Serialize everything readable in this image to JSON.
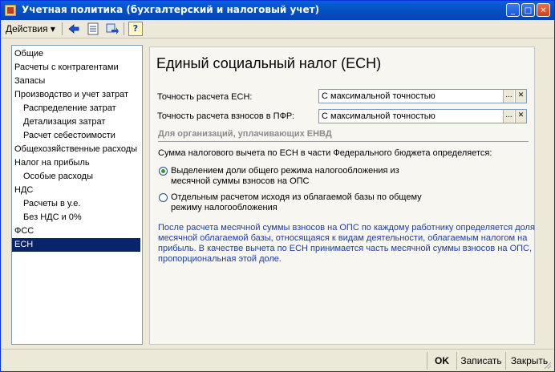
{
  "window": {
    "title": "Учетная политика (бухгалтерский и налоговый учет)",
    "controls": {
      "minimize": "_",
      "maximize": "□",
      "close": "✕"
    }
  },
  "toolbar": {
    "actions_label": "Действия",
    "actions_arrow": "▾",
    "icons": [
      "arrow-left-icon",
      "document-list-icon",
      "move-icon",
      "help-icon"
    ],
    "help_glyph": "?"
  },
  "sidebar": {
    "items": [
      {
        "label": "Общие",
        "indent": 0,
        "selected": false
      },
      {
        "label": "Расчеты с контрагентами",
        "indent": 0,
        "selected": false
      },
      {
        "label": "Запасы",
        "indent": 0,
        "selected": false
      },
      {
        "label": "Производство и учет затрат",
        "indent": 0,
        "selected": false
      },
      {
        "label": "Распределение затрат",
        "indent": 1,
        "selected": false
      },
      {
        "label": "Детализация затрат",
        "indent": 1,
        "selected": false
      },
      {
        "label": "Расчет себестоимости",
        "indent": 1,
        "selected": false
      },
      {
        "label": "Общехозяйственные расходы",
        "indent": 0,
        "selected": false
      },
      {
        "label": "Налог на прибыль",
        "indent": 0,
        "selected": false
      },
      {
        "label": "Особые расходы",
        "indent": 1,
        "selected": false
      },
      {
        "label": "НДС",
        "indent": 0,
        "selected": false
      },
      {
        "label": "Расчеты в у.е.",
        "indent": 1,
        "selected": false
      },
      {
        "label": "Без НДС и 0%",
        "indent": 1,
        "selected": false
      },
      {
        "label": "ФСС",
        "indent": 0,
        "selected": false
      },
      {
        "label": "ЕСН",
        "indent": 0,
        "selected": true
      }
    ]
  },
  "main": {
    "heading": "Единый социальный налог (ЕСН)",
    "fields": [
      {
        "label": "Точность расчета ЕСН:",
        "value": "С максимальной точностью"
      },
      {
        "label": "Точность расчета взносов в ПФР:",
        "value": "С максимальной точностью"
      }
    ],
    "field_buttons": {
      "select": "...",
      "clear": "✕"
    },
    "section_title": "Для организаций, уплачивающих ЕНВД",
    "question": "Сумма налогового вычета по ЕСН в части Федерального бюджета определяется:",
    "options": [
      {
        "line1": "Выделением доли общего режима налогообложения из",
        "line2": "месячной суммы взносов на ОПС",
        "checked": true
      },
      {
        "line1": "Отдельным расчетом исходя из облагаемой базы по общему",
        "line2": "режиму налогообложения",
        "checked": false
      }
    ],
    "note": [
      "После расчета месячной суммы взносов на ОПС по каждому работнику определяется доля",
      "месячной облагаемой базы, относящаяся к видам деятельности, облагаемым налогом на",
      "прибыль. В качестве вычета по ЕСН принимается часть месячной суммы взносов на ОПС,",
      "пропорциональная этой доле."
    ]
  },
  "buttons": {
    "ok": "OK",
    "save": "Записать",
    "close": "Закрыть"
  },
  "colors": {
    "title_bar": "#0553c4",
    "selection": "#0a246a",
    "note_text": "#1f3d9d",
    "section_title": "#8c8c8c"
  }
}
